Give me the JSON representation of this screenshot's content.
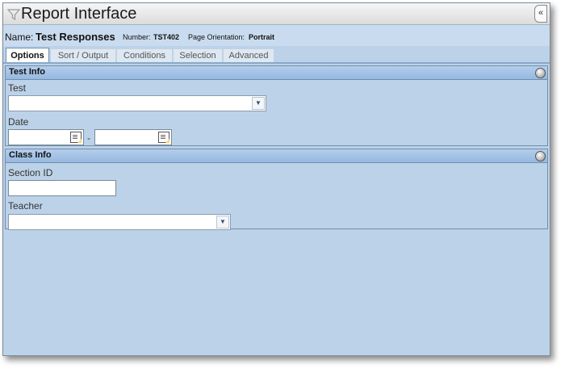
{
  "window": {
    "title": "Report Interface",
    "collapse_glyph": "«"
  },
  "report": {
    "name_label": "Name:",
    "name_value": "Test Responses",
    "number_label": "Number:",
    "number_value": "TST402",
    "orientation_label": "Page Orientation:",
    "orientation_value": "Portrait"
  },
  "tabs": [
    {
      "label": "Options",
      "active": true
    },
    {
      "label": "Sort / Output",
      "active": false
    },
    {
      "label": "Conditions",
      "active": false
    },
    {
      "label": "Selection",
      "active": false
    },
    {
      "label": "Advanced",
      "active": false
    }
  ],
  "test_info": {
    "title": "Test Info",
    "test_label": "Test",
    "test_value": "",
    "date_label": "Date",
    "date_from": "",
    "date_separator": "-",
    "date_to": ""
  },
  "class_info": {
    "title": "Class Info",
    "section_label": "Section ID",
    "section_value": "",
    "teacher_label": "Teacher",
    "teacher_value": ""
  },
  "icons": {
    "title_icon": "filter-icon",
    "panel_toggle": "collapse-circle-icon",
    "dropdown": "chevron-down-icon",
    "calendar": "calendar-icon"
  }
}
